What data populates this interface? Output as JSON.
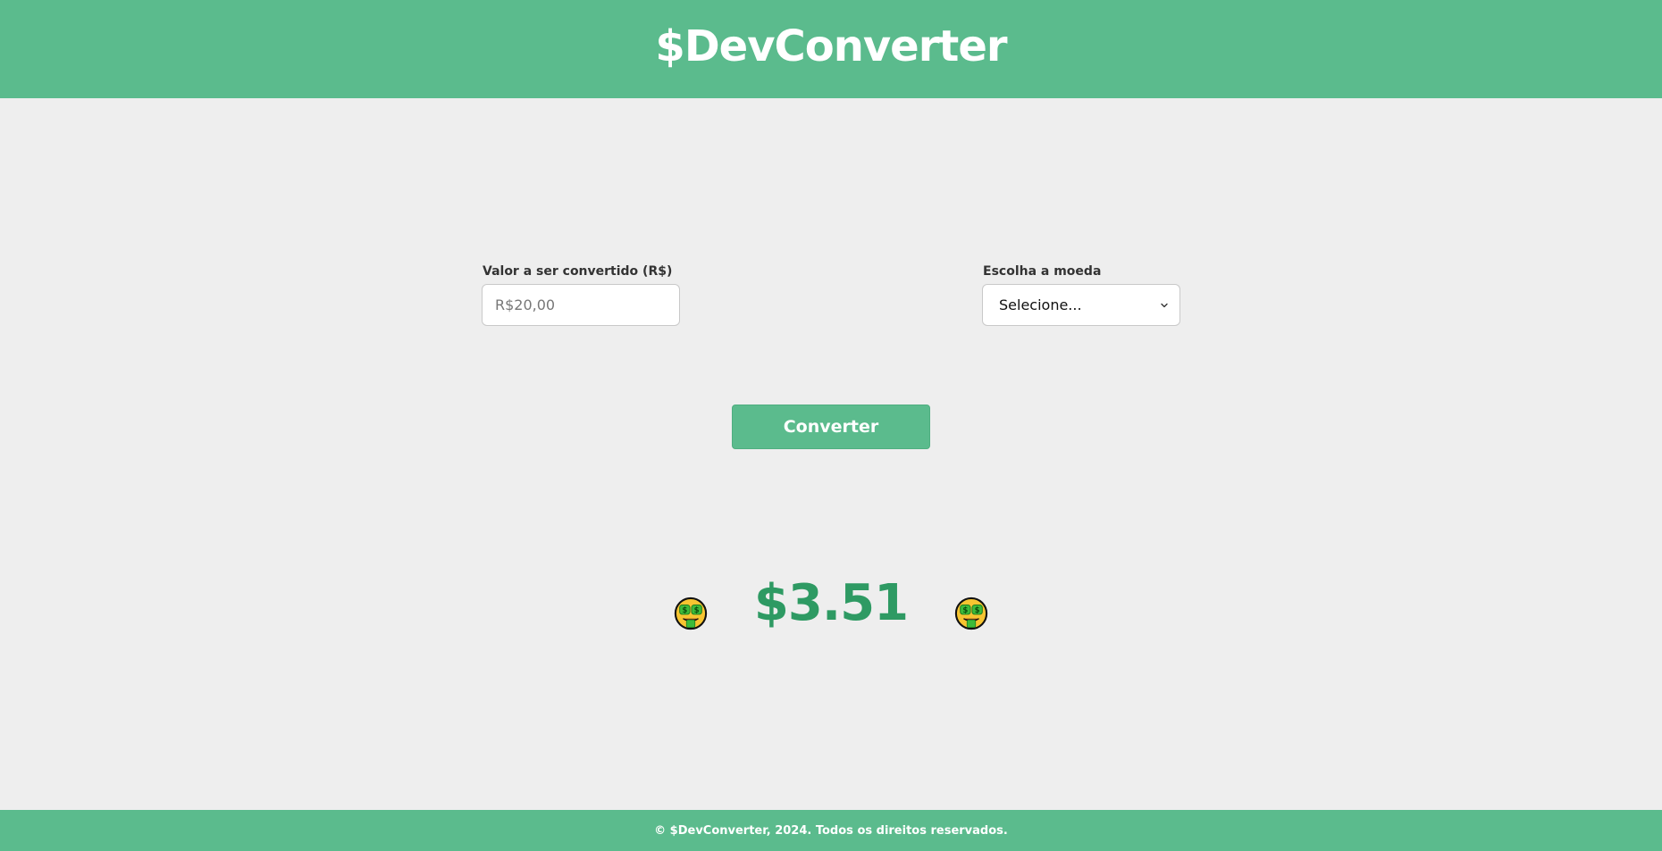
{
  "app": {
    "title": "$DevConverter"
  },
  "form": {
    "amount_label": "Valor a ser convertido (R$)",
    "amount_placeholder": "R$20,00",
    "amount_value": "",
    "currency_label": "Escolha a moeda",
    "currency_selected": "Selecione...",
    "convert_label": "Converter"
  },
  "result": {
    "value": "$3.51",
    "icon": "money-mouth-face-icon"
  },
  "footer": {
    "text": "© $DevConverter, 2024. Todos os direitos reservados."
  },
  "colors": {
    "brand": "#5bbb8d",
    "result": "#2e9a63",
    "background": "#eeeeee"
  }
}
